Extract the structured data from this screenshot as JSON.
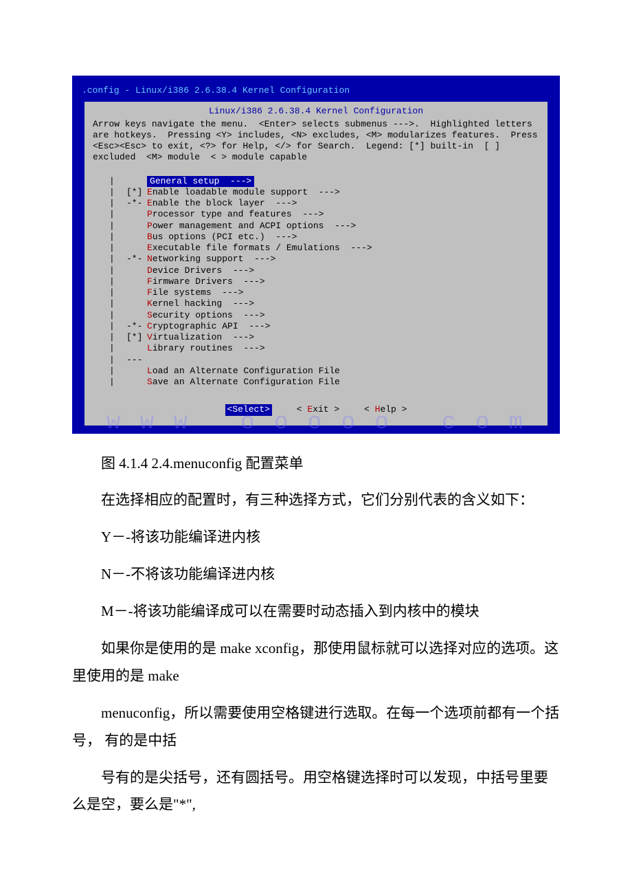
{
  "terminal": {
    "titlebar": ".config - Linux/i386 2.6.38.4 Kernel Configuration",
    "windowTitle": "Linux/i386 2.6.38.4 Kernel Configuration",
    "help": "Arrow keys navigate the menu.  <Enter> selects submenus --->.  Highlighted letters are hotkeys.  Pressing <Y> includes, <N> excludes, <M> modularizes features.  Press <Esc><Esc> to exit, <?> for Help, </> for Search.  Legend: [*] built-in  [ ] excluded  <M> module  < > module capable",
    "menu": [
      {
        "ind": "   ",
        "hot": "G",
        "label": "eneral setup  --->",
        "selected": true
      },
      {
        "ind": "[*]",
        "hot": "E",
        "label": "nable loadable module support  --->"
      },
      {
        "ind": "-*-",
        "hot": "E",
        "label": "nable the block layer  --->"
      },
      {
        "ind": "   ",
        "hot": "P",
        "label": "rocessor type and features  --->"
      },
      {
        "ind": "   ",
        "hot": "P",
        "label": "ower management and ACPI options  --->"
      },
      {
        "ind": "   ",
        "hot": "B",
        "label": "us options (PCI etc.)  --->"
      },
      {
        "ind": "   ",
        "hot": "E",
        "label": "xecutable file formats / Emulations  --->"
      },
      {
        "ind": "-*-",
        "hot": "N",
        "label": "etworking support  --->"
      },
      {
        "ind": "   ",
        "hot": "D",
        "label": "evice Drivers  --->"
      },
      {
        "ind": "   ",
        "hot": "F",
        "label": "irmware Drivers  --->"
      },
      {
        "ind": "   ",
        "hot": "F",
        "label": "ile systems  --->"
      },
      {
        "ind": "   ",
        "hot": "K",
        "label": "ernel hacking  --->"
      },
      {
        "ind": "   ",
        "hot": "S",
        "label": "ecurity options  --->"
      },
      {
        "ind": "-*-",
        "hot": "C",
        "label": "ryptographic API  --->"
      },
      {
        "ind": "[*]",
        "hot": "V",
        "label": "irtualization  --->"
      },
      {
        "ind": "   ",
        "hot": "L",
        "label": "ibrary routines  --->"
      },
      {
        "ind": "---",
        "hot": "",
        "label": ""
      },
      {
        "ind": "   ",
        "hot": "L",
        "label": "oad an Alternate Configuration File"
      },
      {
        "ind": "   ",
        "hot": "S",
        "label": "ave an Alternate Configuration File"
      }
    ],
    "buttons": {
      "select": "<Select>",
      "exit": "< Exit >",
      "exitHot": "E",
      "help": "< Help >",
      "helpHot": "H"
    }
  },
  "doc": {
    "caption": "图 4.1.4 2.4.menuconfig 配置菜单",
    "p1": "在选择相应的配置时，有三种选择方式，它们分别代表的含义如下：",
    "p2": "Y－-将该功能编译进内核",
    "p3": "N－-不将该功能编译进内核",
    "p4": "M－-将该功能编译成可以在需要时动态插入到内核中的模块",
    "p5": "如果你是使用的是 make xconfig，那使用鼠标就可以选择对应的选项。这里使用的是 make",
    "p6": "menuconfig，所以需要使用空格键进行选取。在每一个选项前都有一个括号， 有的是中括",
    "p7": "号有的是尖括号，还有圆括号。用空格键选择时可以发现，中括号里要么是空，要么是\"*\","
  }
}
